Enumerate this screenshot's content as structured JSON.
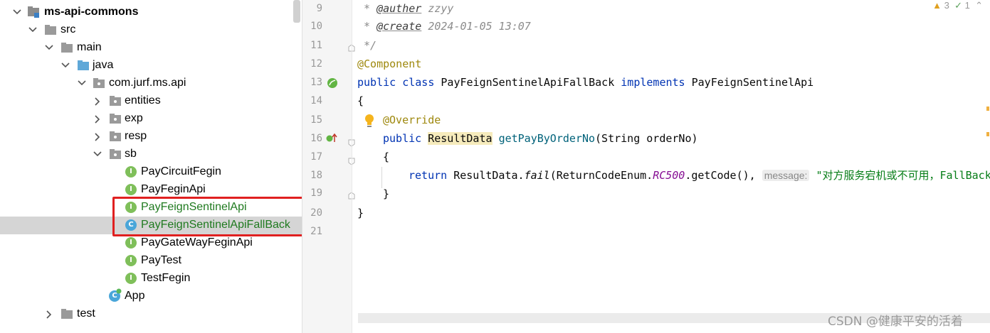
{
  "project_tree": {
    "items": [
      {
        "label": "ms-api-commons",
        "kind": "module"
      },
      {
        "label": "src",
        "kind": "folder"
      },
      {
        "label": "main",
        "kind": "folder"
      },
      {
        "label": "java",
        "kind": "source-folder"
      },
      {
        "label": "com.jurf.ms.api",
        "kind": "package"
      },
      {
        "label": "entities",
        "kind": "package"
      },
      {
        "label": "exp",
        "kind": "package"
      },
      {
        "label": "resp",
        "kind": "package"
      },
      {
        "label": "sb",
        "kind": "package"
      },
      {
        "label": "PayCircuitFegin",
        "kind": "interface"
      },
      {
        "label": "PayFeginApi",
        "kind": "interface"
      },
      {
        "label": "PayFeignSentinelApi",
        "kind": "interface"
      },
      {
        "label": "PayFeignSentinelApiFallBack",
        "kind": "class"
      },
      {
        "label": "PayGateWayFeginApi",
        "kind": "interface"
      },
      {
        "label": "PayTest",
        "kind": "interface"
      },
      {
        "label": "TestFegin",
        "kind": "interface"
      },
      {
        "label": "App",
        "kind": "spring-class"
      },
      {
        "label": "test",
        "kind": "folder"
      }
    ],
    "selected": "PayFeignSentinelApiFallBack",
    "badge_interface": "I",
    "badge_class": "C"
  },
  "editor": {
    "line_numbers": [
      "9",
      "10",
      "11",
      "12",
      "13",
      "14",
      "15",
      "16",
      "17",
      "18",
      "19",
      "20",
      "21"
    ],
    "inspections": {
      "warnings": "3",
      "checks": "1"
    },
    "code": {
      "l9_prefix": " * ",
      "l9_tag": "@auther",
      "l9_value": " zzyy",
      "l10_prefix": " * ",
      "l10_tag": "@create",
      "l10_value": " 2024-01-05 13:07",
      "l11": " */",
      "l12": "@Component",
      "l13_kw1": "public class ",
      "l13_name": "PayFeignSentinelApiFallBack ",
      "l13_kw2": "implements ",
      "l13_iface": "PayFeignSentinelApi",
      "l14": "{",
      "l15": "@Override",
      "l16_kw": "public ",
      "l16_type": "ResultData",
      "l16_sp": " ",
      "l16_method": "getPayByOrderNo",
      "l16_params": "(String orderNo)",
      "l17": "{",
      "l18_kw": "return ",
      "l18_a": "ResultData.",
      "l18_fail": "fail",
      "l18_b": "(ReturnCodeEnum.",
      "l18_const": "RC500",
      "l18_c": ".getCode(), ",
      "l18_hint": "message:",
      "l18_str": "\"对方服务宕机或不可用，FallBack服务降级o(╥﹏╥)o\");",
      "l19": "}",
      "l20": "}"
    }
  },
  "watermark": "CSDN @健康平安的活着",
  "colors": {
    "highlight_box": "#e02020",
    "selection_bg": "#d5d5d5",
    "interface_badge": "#7fbf5a",
    "class_badge": "#4aa6d9",
    "keyword": "#0033b3",
    "annotation": "#9e880d",
    "string": "#067d17",
    "constant": "#871094"
  }
}
